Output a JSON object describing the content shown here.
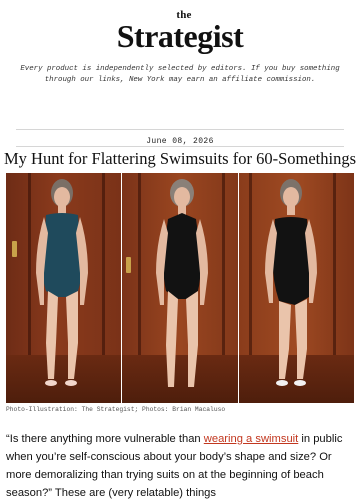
{
  "site": {
    "logo_small": "the",
    "logo_main": "Strategist"
  },
  "disclaimer": "Every product is independently selected by editors. If you buy something through our links, New York may earn an affiliate commission.",
  "article": {
    "date": "June 08, 2026",
    "title": "My Hunt for Flattering Swimsuits for 60-Somethings",
    "photo_alt": "Three photos of a woman trying on swimsuits",
    "photo_credit": "Photo-Illustration: The Strategist; Photos: Brian Macaluso",
    "body_before_link": "“Is there anything more vulnerable than ",
    "body_link": "wearing a swimsuit",
    "body_after_link": " in public when you’re self-conscious about your body’s shape and size? Or more demoralizing than trying suits on at the beginning of beach season?” These are (very relatable) things"
  },
  "colors": {
    "link": "#c2371f",
    "rule": "#d6d6d6",
    "door": "#8a3a1c"
  },
  "swimsuits": [
    {
      "color": "#1f4a5c",
      "style": "tank-one-piece"
    },
    {
      "color": "#121212",
      "style": "halter-one-piece"
    },
    {
      "color": "#121212",
      "style": "wrap-one-piece"
    }
  ]
}
